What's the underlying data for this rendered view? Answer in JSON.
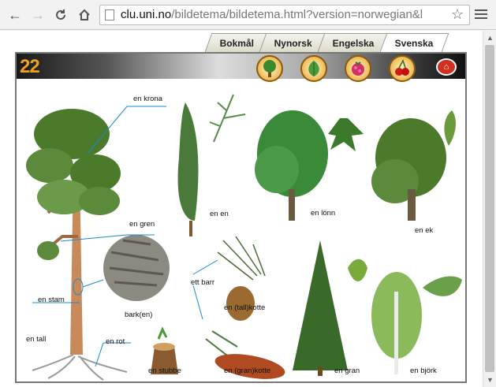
{
  "browser": {
    "url_host": "clu.uni.no",
    "url_rest": "/bildetema/bildetema.html?version=norwegian&l",
    "back": "←",
    "forward": "→",
    "reload": "C",
    "home": "⌂",
    "bookmark": "☆"
  },
  "tabs": [
    {
      "label": "Bokmål",
      "active": false
    },
    {
      "label": "Nynorsk",
      "active": false
    },
    {
      "label": "Engelska",
      "active": false
    },
    {
      "label": "Svenska",
      "active": true
    }
  ],
  "header": {
    "number": "22",
    "categories": [
      "tree-icon",
      "leaf-icon",
      "berry-icon",
      "cherry-icon"
    ],
    "home_icon": "home-icon"
  },
  "labels": {
    "krona": "en krona",
    "gren": "en gren",
    "stam": "en stam",
    "tall": "en tall",
    "rot": "en rot",
    "bark": "bark(en)",
    "stubbe": "en stubbe",
    "en": "en en",
    "lonn": "en lönn",
    "ek": "en ek",
    "barr": "ett barr",
    "tallkotte": "en (tall)kotte",
    "grankotte": "en (gran)kotte",
    "gran": "en gran",
    "bjork": "en björk"
  },
  "colors": {
    "foliage": "#4a7a2a",
    "trunk": "#c88a5a",
    "line": "#1a8ad0"
  }
}
